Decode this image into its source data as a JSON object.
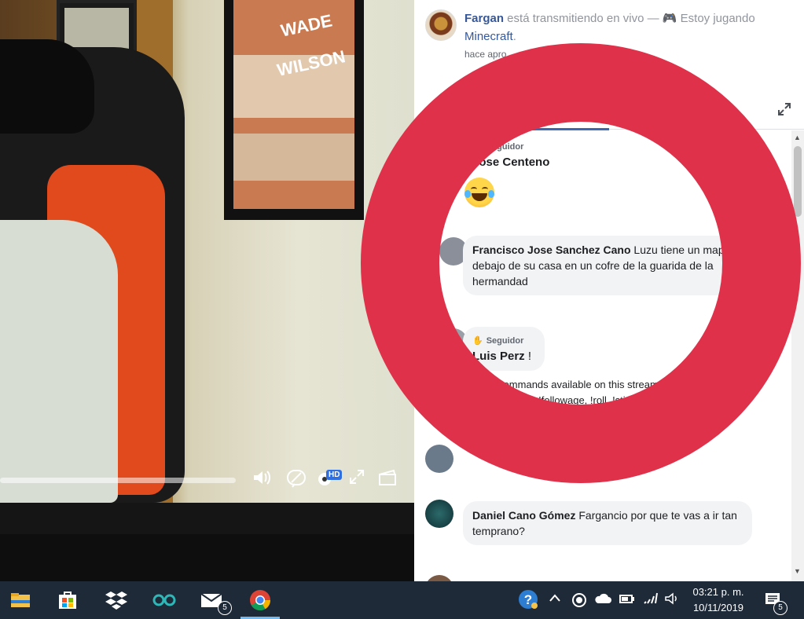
{
  "video": {
    "poster_text_1": "WADE",
    "poster_text_2": "WILSON",
    "hd_label": "HD",
    "controls": {
      "volume_icon": "volume-icon",
      "captions_icon": "captions-off-icon",
      "settings_icon": "gear-icon",
      "fullscreen_icon": "expand-icon",
      "clip_icon": "clapperboard-icon"
    }
  },
  "header": {
    "streamer": "Fargan",
    "status_text": " está transmitiendo en vivo — ",
    "activity_text": "Estoy jugando ",
    "game": "Minecraft",
    "period": ".",
    "time": "hace apro"
  },
  "chat": {
    "messages": [
      {
        "badge": "Seguidor",
        "author": "Jose Centeno",
        "text": ""
      },
      {
        "author": "Francisco Jose Sanchez Cano",
        "text": " Luzu tiene un mapa debajo de su casa en un cofre de la guarida de la hermandad"
      },
      {
        "badge": "Seguidor",
        "author": "Luis Perz",
        "text": " !"
      },
      {
        "system_line1": "Chat commands available on this stream: !co",
        "system_line2": "laying, !notify, !followage, !roll, !stickers"
      },
      {
        "author": "Daniel Cano Gómez",
        "text": " Fargancio por que te vas a ir tan temprano?"
      }
    ]
  },
  "taskbar": {
    "icons": [
      "file-explorer-icon",
      "store-icon",
      "dropbox-icon",
      "arduino-icon",
      "mail-icon",
      "chrome-icon"
    ],
    "mail_count": "5",
    "clock_time": "03:21 p. m.",
    "clock_date": "10/11/2019",
    "notification_count": "5"
  },
  "colors": {
    "accent": "#365899",
    "ring": "#e0314a",
    "taskbar": "#1f2a38"
  }
}
